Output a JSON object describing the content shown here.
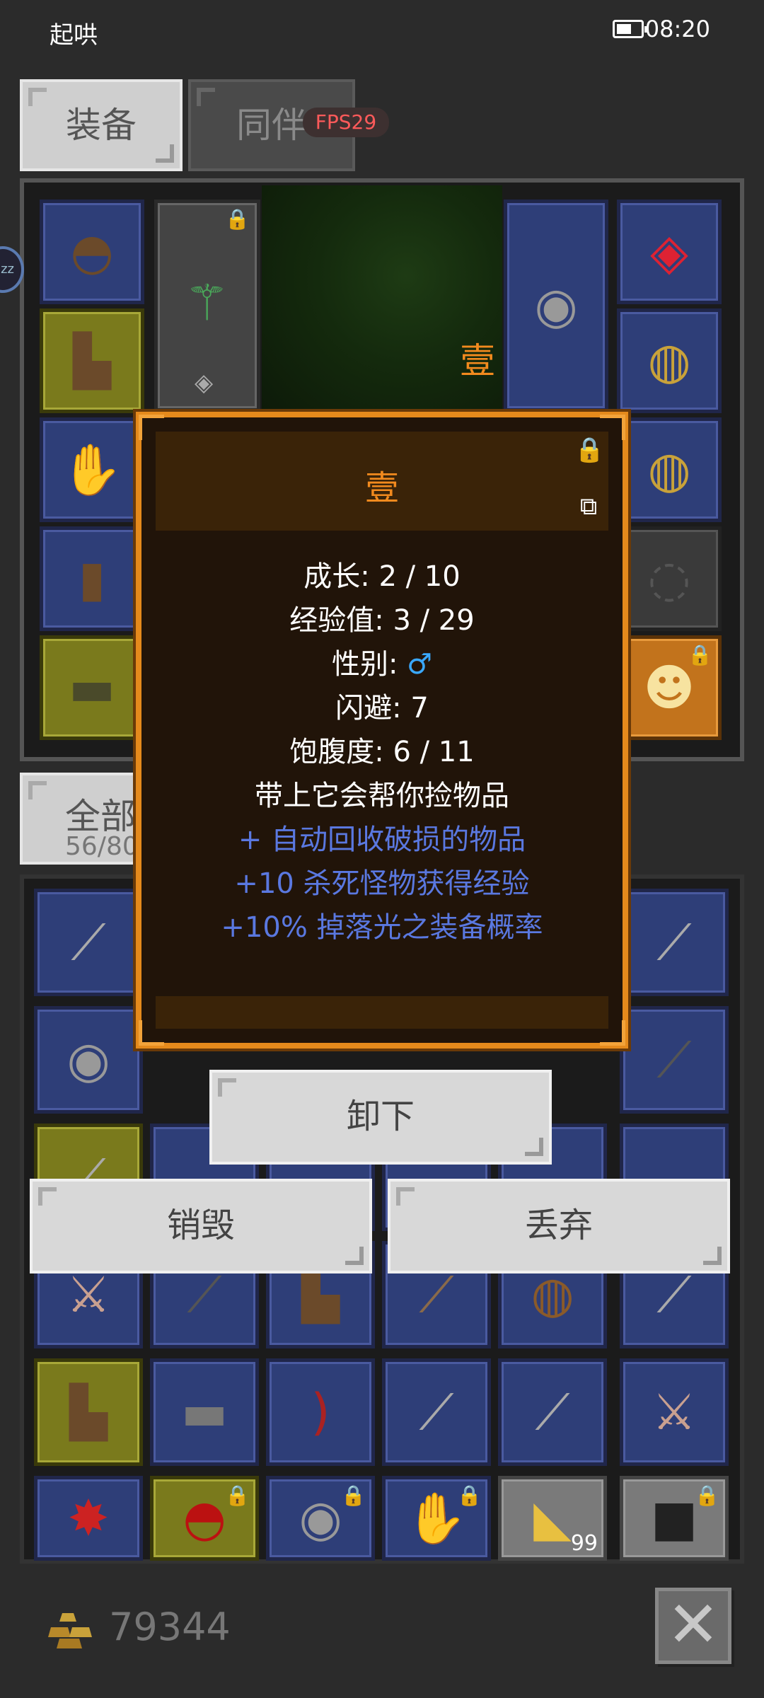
{
  "status_bar": {
    "app_name": "起哄",
    "time": "08:20"
  },
  "tabs": [
    {
      "label": "装备"
    },
    {
      "label": "同伴"
    }
  ],
  "fps": "FPS29",
  "scene_label": "壹",
  "inventory": {
    "filter_label": "全部",
    "count": "56/80"
  },
  "tooltip": {
    "title": "壹",
    "lines": [
      {
        "text": "成长: 2 / 10"
      },
      {
        "text": "经验值: 3 / 29"
      },
      {
        "text": "性别: ",
        "symbol": "♂"
      },
      {
        "text": "闪避: 7"
      },
      {
        "text": "饱腹度: 6 / 11"
      },
      {
        "text": "带上它会帮你捡物品"
      },
      {
        "text": "+ 自动回收破损的物品"
      },
      {
        "text": "+10 杀死怪物获得经验"
      },
      {
        "text": "+10% 掉落光之装备概率"
      }
    ]
  },
  "actions": {
    "unequip": "卸下",
    "destroy": "销毁",
    "discard": "丢弃"
  },
  "gold": "79344",
  "side_bubble": "zz",
  "stack_count": "99"
}
